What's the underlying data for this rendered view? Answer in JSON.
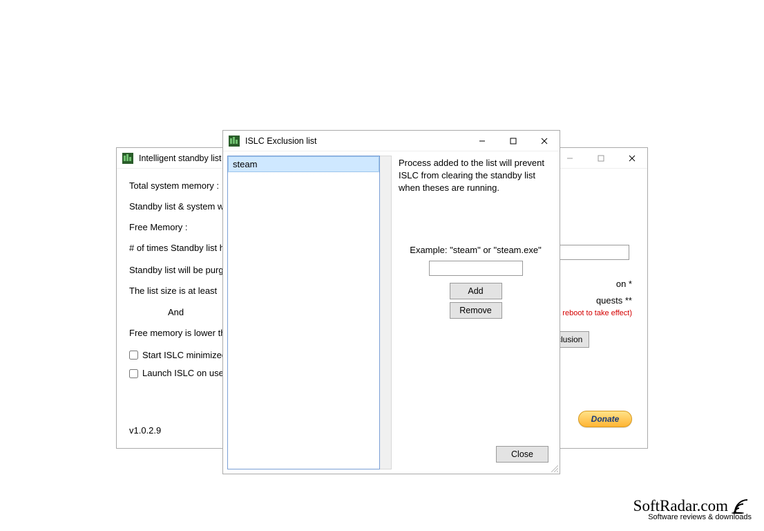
{
  "main_window": {
    "title": "Intelligent standby list cleaner",
    "labels": {
      "total_mem": "Total system memory :",
      "standby_sys": "Standby list & system working set :",
      "free_mem": "Free Memory :",
      "times_purged": "# of times Standby list has been purged :",
      "purge_rule": "Standby list will be purged when :",
      "size_least": "The list size is at least",
      "and": "And",
      "free_lower": "Free memory is lower than",
      "chk_minimized": "Start ISLC minimized",
      "chk_launch": "Launch ISLC on user logon",
      "version": "v1.0.2.9",
      "donate": "Donate",
      "exclusion": "xclusion",
      "reboot_note": "quire a reboot to take effect)",
      "partial1": "on *",
      "partial2": "quests **"
    }
  },
  "excl_window": {
    "title": "ISLC Exclusion list",
    "list_items": [
      "steam"
    ],
    "desc": "Process added to the list will prevent ISLC from clearing the standby list when theses are running.",
    "example": "Example: \"steam\" or \"steam.exe\"",
    "add": "Add",
    "remove": "Remove",
    "close": "Close"
  },
  "watermark": {
    "brand": "SoftRadar.com",
    "tag": "Software reviews & downloads"
  }
}
